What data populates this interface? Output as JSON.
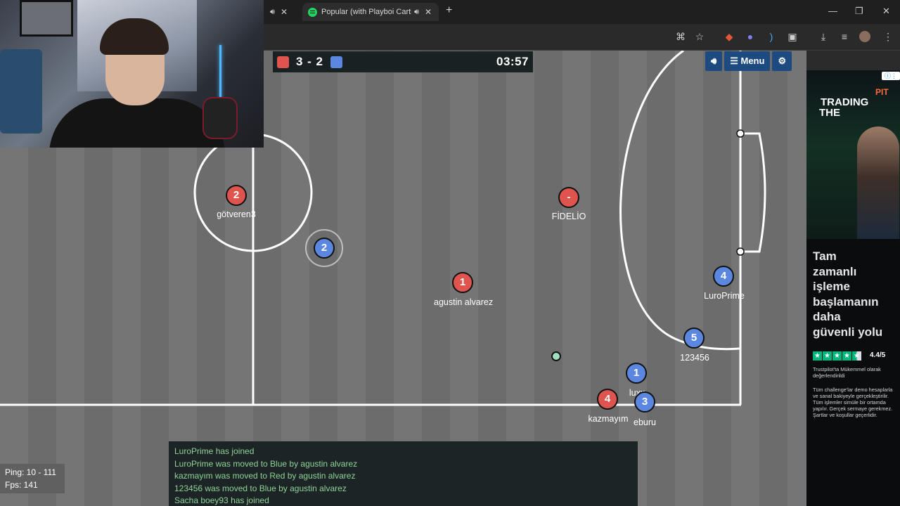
{
  "browser": {
    "tabs": [
      {
        "title": "",
        "active": false
      },
      {
        "title": "Popular (with Playboi Carti",
        "active": true
      }
    ],
    "tab_close": "✕",
    "new_tab": "+",
    "window": {
      "minimize": "—",
      "maximize": "❐",
      "close": "✕"
    }
  },
  "game": {
    "score": "3 - 2",
    "timer": "03:57",
    "team_colors": {
      "red": "#e0544f",
      "blue": "#5b87e0"
    },
    "menu_label": "Menu",
    "players": [
      {
        "team": "red",
        "number": "2",
        "name": "götveren3"
      },
      {
        "team": "blue",
        "number": "2",
        "name": ""
      },
      {
        "team": "red",
        "number": "-",
        "name": "FİDELİO"
      },
      {
        "team": "red",
        "number": "1",
        "name": "agustin alvarez"
      },
      {
        "team": "blue",
        "number": "4",
        "name": "LuroPrime"
      },
      {
        "team": "blue",
        "number": "5",
        "name": "123456"
      },
      {
        "team": "blue",
        "number": "1",
        "name": "luxx"
      },
      {
        "team": "red",
        "number": "4",
        "name": "kazmayım"
      },
      {
        "team": "blue",
        "number": "3",
        "name": "eburu"
      }
    ],
    "chat": [
      "LuroPrime has joined",
      "LuroPrime was moved to Blue by agustin alvarez",
      "kazmayım was moved to Red by agustin alvarez",
      "123456 was moved to Blue by agustin alvarez",
      "Sacha boey93 has joined"
    ],
    "ping": "Ping: 10 - 111",
    "fps": "Fps: 141"
  },
  "ad": {
    "brand": "PIT",
    "title": [
      "TRADING",
      "THE"
    ],
    "headline": [
      "Tam",
      "zamanlı",
      "işleme",
      "başlamanın",
      "daha",
      "güvenli yolu"
    ],
    "rating": "4.4/5",
    "trust_text": "Trustpilot'ta Mükemmel olarak değerlendirildi",
    "disclaimer": "Tüm challenge'lar demo hesaplarla ve sanal bakiyeyle gerçekleştirilir. Tüm işlemler simüle bir ortamda yapılır. Gerçek sermaye gerekmez. Şartlar ve koşullar geçerlidir."
  }
}
